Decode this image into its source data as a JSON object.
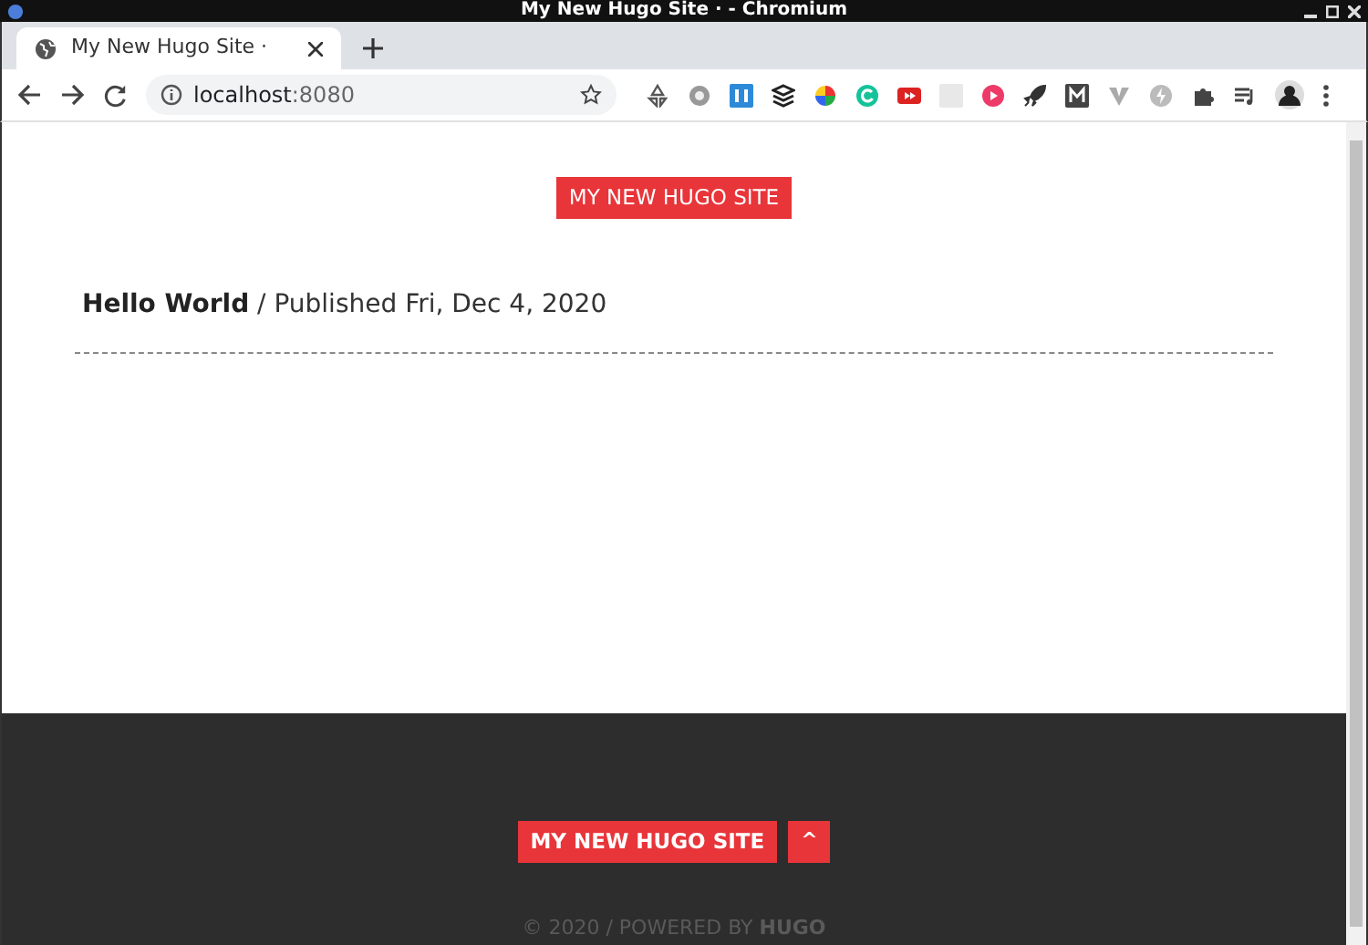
{
  "window": {
    "title": "My New Hugo Site · - Chromium"
  },
  "tabs": [
    {
      "title": "My New Hugo Site ·",
      "selected": true
    }
  ],
  "address_bar": {
    "host": "localhost",
    "port": ":8080"
  },
  "header": {
    "site_title": "MY NEW HUGO SITE"
  },
  "posts": [
    {
      "line": "**Hello World** / Published Fri, Dec 4, 2020"
    }
  ],
  "footer": {
    "site_title": "MY NEW HUGO SITE",
    "top_button": "^",
    "copyright": "© 2020 / POWERED BY **HUGO**"
  }
}
